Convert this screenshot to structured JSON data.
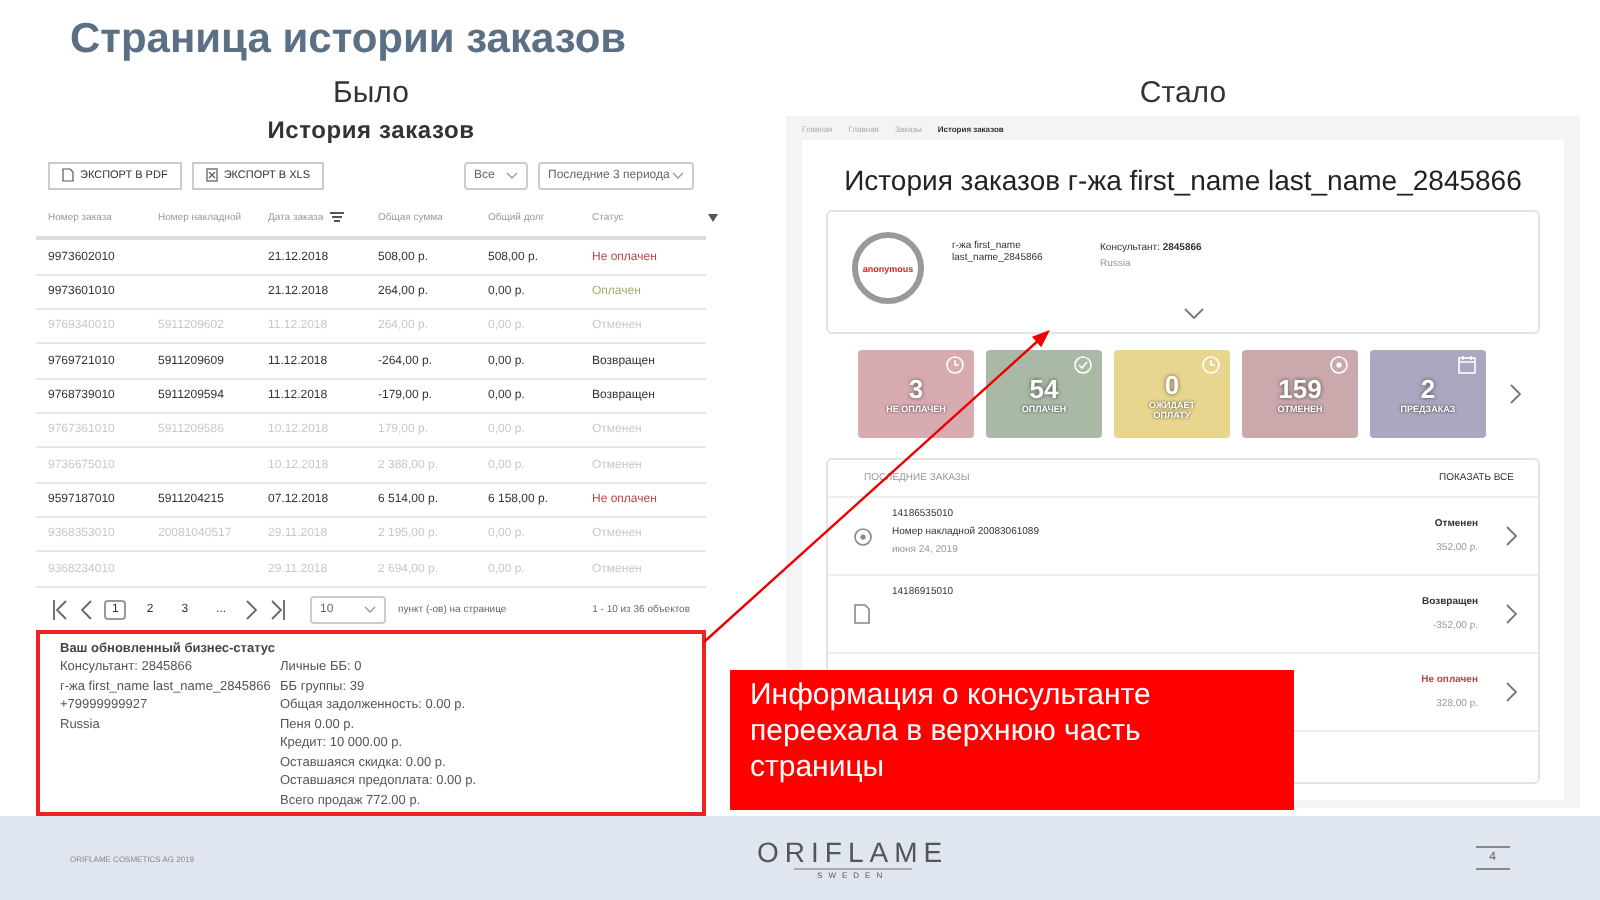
{
  "slide_title": "Страница истории заказов",
  "before": {
    "heading": "Было",
    "title": "История заказов",
    "export_buttons": [
      {
        "label": "ЭКСПОРТ В PDF",
        "kind": "pdf"
      },
      {
        "label": "ЭКСПОРТ В XLS",
        "kind": "xls"
      }
    ],
    "filters": [
      "Все",
      "Последние 3 периода"
    ],
    "columns": [
      {
        "label": "Номер заказа"
      },
      {
        "label": "Номер накладной"
      },
      {
        "label": "Дата заказа",
        "kind": "sort"
      },
      {
        "label": "Общая сумма"
      },
      {
        "label": "Общий долг"
      },
      {
        "label": "Статус",
        "kind": "filter"
      }
    ],
    "rows": [
      {
        "order": "9973602010",
        "date": "21.12.2018",
        "total": "508,00 р.",
        "debt": "508,00 р.",
        "status": "Не оплачен",
        "kind": "unpaid",
        "faded": false
      },
      {
        "order": "9973601010",
        "date": "21.12.2018",
        "total": "264,00 р.",
        "debt": "0,00 р.",
        "status": "Оплачен",
        "kind": "paid",
        "faded": false
      },
      {
        "order": "9769340010",
        "invoice": "5911209602",
        "date": "11.12.2018",
        "total": "264,00 р.",
        "debt": "0,00 р.",
        "status": "Отменен",
        "kind": "cancelled",
        "faded": true
      },
      {
        "order": "9769721010",
        "invoice": "5911209609",
        "date": "11.12.2018",
        "total": "-264,00 р.",
        "debt": "0,00 р.",
        "status": "Возвращен",
        "kind": "returned",
        "faded": false
      },
      {
        "order": "9768739010",
        "invoice": "5911209594",
        "date": "11.12.2018",
        "total": "-179,00 р.",
        "debt": "0,00 р.",
        "status": "Возвращен",
        "kind": "returned",
        "faded": false
      },
      {
        "order": "9767361010",
        "invoice": "5911209586",
        "date": "10.12.2018",
        "total": "179,00 р.",
        "debt": "0,00 р.",
        "status": "Отменен",
        "kind": "cancelled",
        "faded": true
      },
      {
        "order": "9736675010",
        "date": "10.12.2018",
        "total": "2 388,00 р.",
        "debt": "0,00 р.",
        "status": "Отменен",
        "kind": "cancelled",
        "faded": true
      },
      {
        "order": "9597187010",
        "invoice": "5911204215",
        "date": "07.12.2018",
        "total": "6 514,00 р.",
        "debt": "6 158,00 р.",
        "status": "Не оплачен",
        "kind": "unpaid",
        "faded": false
      },
      {
        "order": "9368353010",
        "invoice": "20081040517",
        "date": "29.11.2018",
        "total": "2 195,00 р.",
        "debt": "0,00 р.",
        "status": "Отменен",
        "kind": "cancelled",
        "faded": true
      },
      {
        "order": "9368234010",
        "date": "29.11.2018",
        "total": "2 694,00 р.",
        "debt": "0,00 р.",
        "status": "Отменен",
        "kind": "cancelled",
        "faded": true
      }
    ],
    "pages": [
      {
        "label": "1",
        "selected": true
      },
      {
        "label": "2",
        "selected": false
      },
      {
        "label": "3",
        "selected": false
      },
      {
        "label": "...",
        "selected": false
      }
    ],
    "per_page": "10",
    "per_page_label": "пункт (-ов) на странице",
    "range": "1 - 10 из 36 объектов",
    "info": {
      "heading": "Ваш обновленный бизнес-статус",
      "left": [
        "Консультант: 2845866",
        "г-жа first_name last_name_2845866",
        "+79999999927",
        "Russia"
      ],
      "right": [
        "Личные ББ: 0",
        "ББ группы: 39",
        "Общая задолженность: 0.00 р.",
        "Пеня 0.00 р.",
        "Кредит: 10 000.00 р.",
        "Оставшаяся скидка: 0.00 р.",
        "Оставшаяся предоплата: 0.00 р.",
        "Всего продаж 772.00 р."
      ]
    }
  },
  "after": {
    "heading": "Стало",
    "breadcrumbs": [
      {
        "label": "Главная",
        "selected": false
      },
      {
        "label": "Главная",
        "selected": false
      },
      {
        "label": "Заказы",
        "selected": false
      },
      {
        "label": "История заказов",
        "selected": true
      }
    ],
    "title": "История заказов г-жа first_name last_name_2845866",
    "profile": {
      "avatar_label": "anonymous",
      "name": "г-жа first_name last_name_2845866",
      "consultant": "Консультант: **2845866**",
      "country": "Russia"
    },
    "tiles": [
      {
        "count": "3",
        "label": "НЕ ОПЛАЧЕН",
        "color": "#d8abb1",
        "kind": "clock"
      },
      {
        "count": "54",
        "label": "ОПЛАЧЕН",
        "color": "#aab9a6",
        "kind": "check"
      },
      {
        "count": "0",
        "label": "ОЖИДАЕТ ОПЛАТУ",
        "color": "#e8d58e",
        "kind": "clock"
      },
      {
        "count": "159",
        "label": "ОТМЕНЕН",
        "color": "#c9a9ac",
        "kind": "dot"
      },
      {
        "count": "2",
        "label": "ПРЕДЗАКАЗ",
        "color": "#aaa7c0",
        "kind": "calendar"
      }
    ],
    "latest": {
      "title": "ПОСЛЕДНИЕ ЗАКАЗЫ",
      "show_all": "ПОКАЗАТЬ ВСЕ",
      "orders": [
        {
          "number": "14186535010",
          "invoice": "Номер накладной 20083061089",
          "date": "июня 24, 2019",
          "status": "Отменен",
          "kind": "cancelled",
          "amount": "352,00 р."
        },
        {
          "number": "14186915010",
          "status": "Возвращен",
          "kind": "returned",
          "amount": "-352,00 р."
        },
        {
          "status": "Не оплачен",
          "kind": "unpaid",
          "amount": "328,00 р."
        }
      ]
    }
  },
  "callout": "Информация о консультанте переехала в верхнюю часть страницы",
  "footer": {
    "copyright": "ORIFLAME COSMETICS AG 2019",
    "logo": "ORIFLAME",
    "logo_sub": "SWEDEN",
    "page": "4"
  }
}
